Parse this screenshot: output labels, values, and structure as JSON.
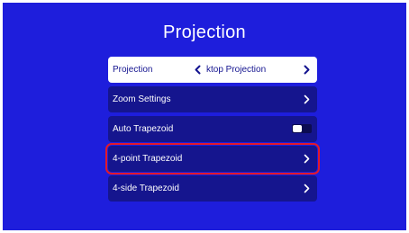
{
  "title": "Projection",
  "colors": {
    "background": "#1e1edc",
    "item_background": "#15158e",
    "selected_background": "#ffffff",
    "focus_outline": "#e2192b"
  },
  "menu": {
    "items": [
      {
        "label": "Projection",
        "value": "Desktop Projection",
        "visible_value": "ktop Projection",
        "icon": "chevron-right-icon"
      },
      {
        "label": "Zoom Settings",
        "icon": "chevron-right-icon"
      },
      {
        "label": "Auto Trapezoid",
        "toggle": "off"
      },
      {
        "label": "4-point Trapezoid",
        "icon": "chevron-right-icon"
      },
      {
        "label": "4-side Trapezoid",
        "icon": "chevron-right-icon"
      }
    ]
  }
}
